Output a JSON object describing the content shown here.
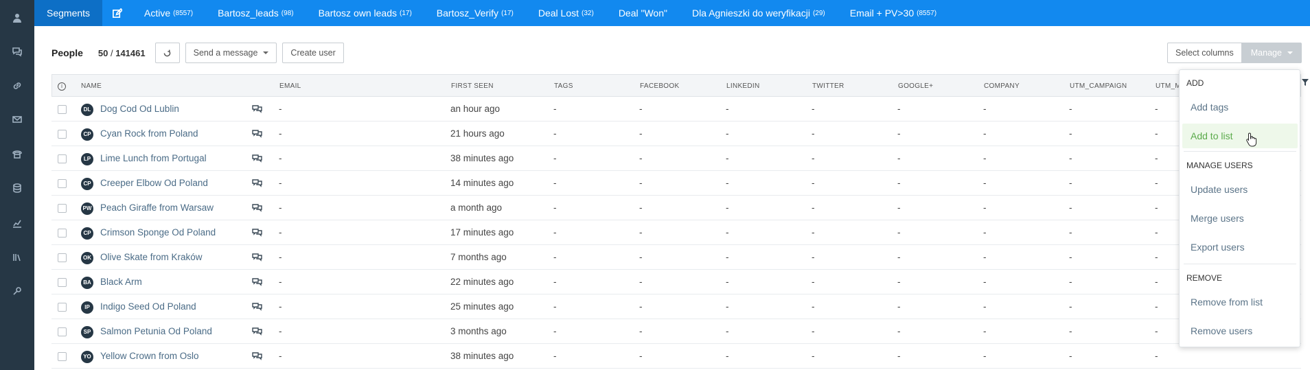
{
  "sidebar": {
    "icons": [
      "user-icon",
      "chat-icon",
      "link-icon",
      "mail-icon",
      "phone-icon",
      "database-icon",
      "chart-icon",
      "library-icon",
      "settings-icon"
    ]
  },
  "tabs": [
    {
      "label": "Segments",
      "count": ""
    },
    {
      "label": "Active",
      "count": "(8557)"
    },
    {
      "label": "Bartosz_leads",
      "count": "(98)"
    },
    {
      "label": "Bartosz own leads",
      "count": "(17)"
    },
    {
      "label": "Bartosz_Verify",
      "count": "(17)"
    },
    {
      "label": "Deal Lost",
      "count": "(32)"
    },
    {
      "label": "Deal \"Won\"",
      "count": ""
    },
    {
      "label": "Dla Agnieszki do weryfikacji",
      "count": "(29)"
    },
    {
      "label": "Email + PV>30",
      "count": "(8557)"
    }
  ],
  "toolbar": {
    "people_label": "People",
    "count_shown": "50",
    "count_sep": " / ",
    "count_total": "141461",
    "send_message_label": "Send a message",
    "create_user_label": "Create user",
    "select_columns_label": "Select columns",
    "manage_label": "Manage"
  },
  "columns": [
    "Name",
    "Email",
    "First seen",
    "Tags",
    "Facebook",
    "LinkedIn",
    "Twitter",
    "Google+",
    "Company",
    "utm_campaign",
    "utm_m"
  ],
  "rows": [
    {
      "initials": "DL",
      "name": "Dog Cod Od Lublin",
      "email": "-",
      "first_seen": "an hour ago"
    },
    {
      "initials": "CP",
      "name": "Cyan Rock from Poland",
      "email": "-",
      "first_seen": "21 hours ago"
    },
    {
      "initials": "LP",
      "name": "Lime Lunch from Portugal",
      "email": "-",
      "first_seen": "38 minutes ago"
    },
    {
      "initials": "CP",
      "name": "Creeper Elbow Od Poland",
      "email": "-",
      "first_seen": "14 minutes ago"
    },
    {
      "initials": "PW",
      "name": "Peach Giraffe from Warsaw",
      "email": "-",
      "first_seen": "a month ago"
    },
    {
      "initials": "CP",
      "name": "Crimson Sponge Od Poland",
      "email": "-",
      "first_seen": "17 minutes ago"
    },
    {
      "initials": "OK",
      "name": "Olive Skate from Kraków",
      "email": "-",
      "first_seen": "7 months ago"
    },
    {
      "initials": "BA",
      "name": "Black Arm",
      "email": "-",
      "first_seen": "22 minutes ago"
    },
    {
      "initials": "IP",
      "name": "Indigo Seed Od Poland",
      "email": "-",
      "first_seen": "25 minutes ago"
    },
    {
      "initials": "SP",
      "name": "Salmon Petunia Od Poland",
      "email": "-",
      "first_seen": "3 months ago"
    },
    {
      "initials": "YO",
      "name": "Yellow Crown from Oslo",
      "email": "-",
      "first_seen": "38 minutes ago"
    }
  ],
  "empty_value": "-",
  "manage_menu": {
    "add_heading": "Add",
    "add_tags": "Add tags",
    "add_to_list": "Add to list",
    "manage_heading": "Manage users",
    "update_users": "Update users",
    "merge_users": "Merge users",
    "export_users": "Export users",
    "remove_heading": "Remove",
    "remove_from_list": "Remove from list",
    "remove_users": "Remove users"
  },
  "colors": {
    "sidebar": "#263745",
    "topnav": "#1289ef",
    "link": "#4a6b86",
    "hover_green": "#5aaa4a"
  }
}
